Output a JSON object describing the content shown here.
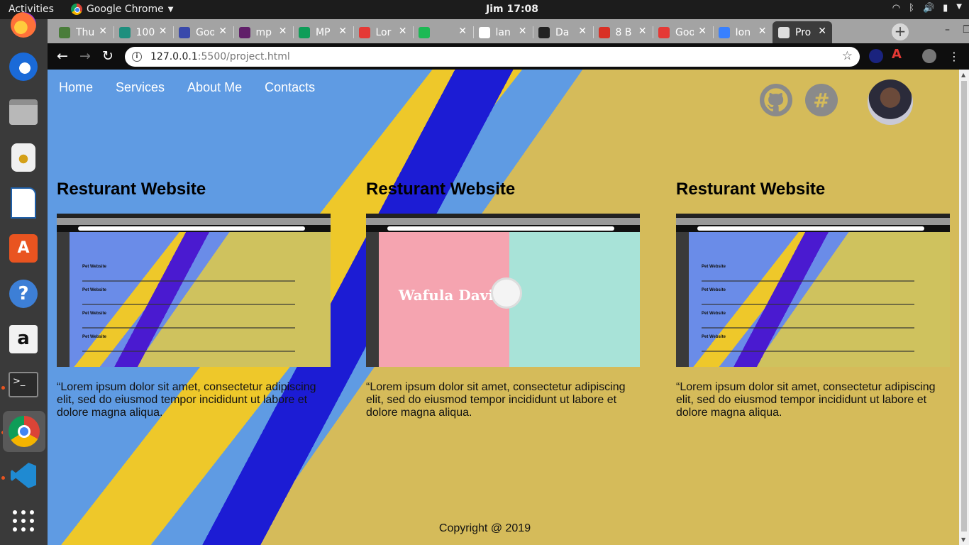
{
  "system": {
    "activities": "Activities",
    "app_name": "Google Chrome",
    "clock": "Jim 17:08"
  },
  "dock": {
    "apps": [
      "firefox",
      "thunderbird",
      "files",
      "rhythmbox",
      "libreoffice-writer",
      "ubuntu-software",
      "help",
      "amazon",
      "terminal",
      "google-chrome",
      "vscode",
      "show-applications"
    ]
  },
  "browser": {
    "tabs": [
      {
        "label": "Thu",
        "icon": "tree",
        "color": "#4a7d3a"
      },
      {
        "label": "100",
        "icon": "d-square",
        "color": "#1e8f7e"
      },
      {
        "label": "Goo",
        "icon": "calendar-24",
        "color": "#3949ab"
      },
      {
        "label": "mp",
        "icon": "slack",
        "color": "#611f69"
      },
      {
        "label": "MP",
        "icon": "sheets-plus",
        "color": "#0f9d58"
      },
      {
        "label": "Lor",
        "icon": "person-red",
        "color": "#e53935"
      },
      {
        "label": "",
        "icon": "spotify",
        "color": "#1db954"
      },
      {
        "label": "lan",
        "icon": "google",
        "color": "#ffffff"
      },
      {
        "label": "Da",
        "icon": "github",
        "color": "#222222"
      },
      {
        "label": "8 B",
        "icon": "gmail-m",
        "color": "#d93025"
      },
      {
        "label": "Goo",
        "icon": "f-red",
        "color": "#e53935"
      },
      {
        "label": "Ion",
        "icon": "ionic",
        "color": "#3880ff"
      },
      {
        "label": "Pro",
        "icon": "globe",
        "color": "#dddddd"
      }
    ],
    "url_host": "127.0.0.1",
    "url_rest": ":5500/project.html",
    "window_controls": [
      "–",
      "❐",
      "✕"
    ]
  },
  "page": {
    "nav": [
      "Home",
      "Services",
      "About Me",
      "Contacts"
    ],
    "projects": [
      {
        "title": "Resturant Website",
        "preview": "pencil",
        "preview_labels": [
          "Pet Website",
          "Pet Website",
          "Pet Website",
          "Pet Website"
        ],
        "description": "“Lorem ipsum dolor sit amet, consectetur adipiscing elit, sed do eiusmod tempor incididunt ut labore et dolore magna aliqua."
      },
      {
        "title": "Resturant Website",
        "preview": "clock",
        "preview_name": "Wafula Davis",
        "description": "“Lorem ipsum dolor sit amet, consectetur adipiscing elit, sed do eiusmod tempor incididunt ut labore et dolore magna aliqua."
      },
      {
        "title": "Resturant Website",
        "preview": "pencil",
        "preview_labels": [
          "Pet Website",
          "Pet Website",
          "Pet Website",
          "Pet Website"
        ],
        "description": "“Lorem ipsum dolor sit amet, consectetur adipiscing elit, sed do eiusmod tempor incididunt ut labore et dolore magna aliqua."
      }
    ],
    "copyright": "Copyright @ 2019"
  }
}
